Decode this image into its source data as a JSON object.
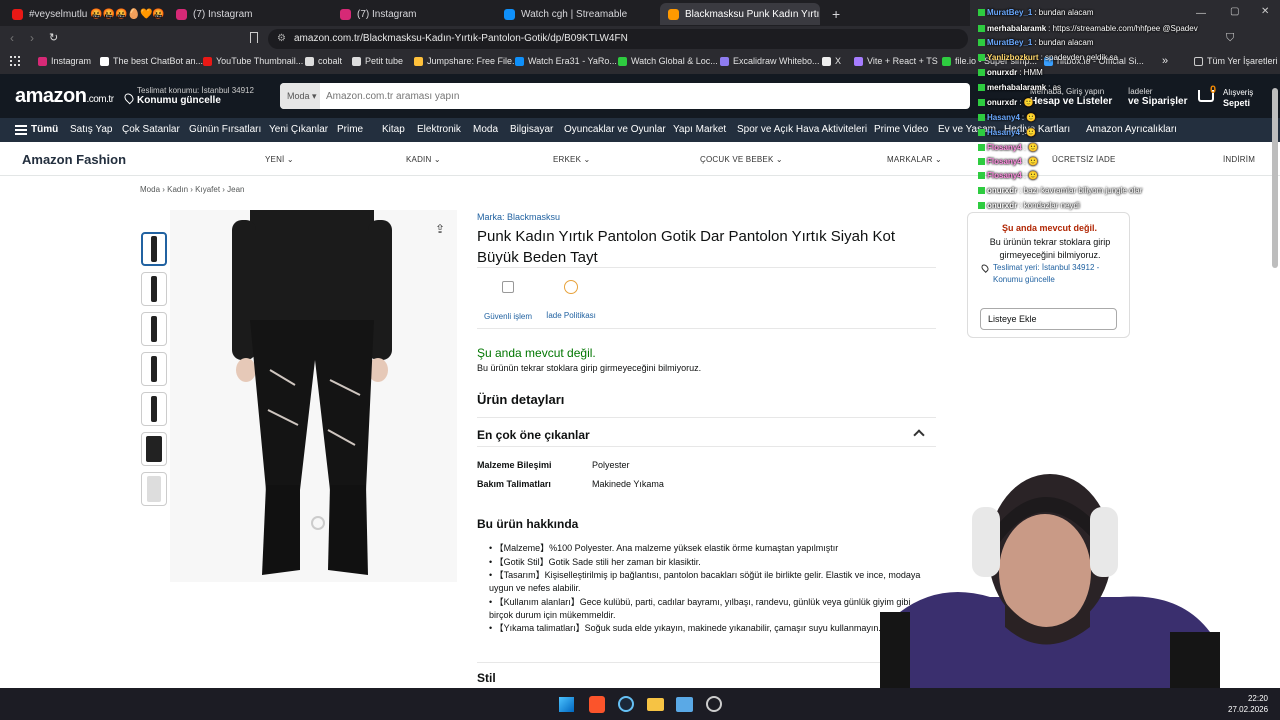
{
  "tabs": [
    {
      "label": "#veyselmutlu 🤬🤬🤬🥚🧡🤬 #veyselmutlu",
      "color": "#e91916"
    },
    {
      "label": "(7) Instagram",
      "color": "#d62976"
    },
    {
      "label": "(7) Instagram",
      "color": "#d62976"
    },
    {
      "label": "Watch cgh | Streamable",
      "color": "#0f90fa"
    },
    {
      "label": "Blackmasksu Punk Kadın Yırtık P",
      "color": "#ff9900"
    }
  ],
  "url": "amazon.com.tr/Blackmasksu-Kadın-Yırtık-Pantolon-Gotik/dp/B09KTLW4FN",
  "bookmarks": [
    "Instagram",
    "The best ChatBot an...",
    "YouTube Thumbnail...",
    "cobalt",
    "Petit tube",
    "Jumpshare: Free File...",
    "Watch Era31 - YaRo...",
    "Watch Global & Loc...",
    "Excalidraw Whitebo...",
    "X",
    "Vite + React + TS",
    "file.io - Super simp...",
    "hitbox.io - Official Si..."
  ],
  "bookmarks_all": "Tüm Yer İşaretleri",
  "amazon": {
    "logo": "amazon",
    "logo_tld": ".com.tr",
    "deliver_line1": "Teslimat konumu: İstanbul 34912",
    "deliver_line2": "Konumu güncelle",
    "search_category": "Moda",
    "search_placeholder": "Amazon.com.tr araması yapın",
    "account_line1": "Merhaba, Giriş yapın",
    "account_line2": "Hesap ve Listeler",
    "orders_line1": "İadeler",
    "orders_line2": "ve Siparişler",
    "cart_count": "0",
    "cart_line1": "Alışveriş",
    "cart_line2": "Sepeti"
  },
  "nav": [
    "Tümü",
    "Satış Yap",
    "Çok Satanlar",
    "Günün Fırsatları",
    "Yeni Çıkanlar",
    "Prime",
    "Kitap",
    "Elektronik",
    "Moda",
    "Bilgisayar",
    "Oyuncaklar ve Oyunlar",
    "Yapı Market",
    "Spor ve Açık Hava Aktiviteleri",
    "Prime Video",
    "Ev ve Yaşam",
    "Hediye Kartları",
    "Amazon Ayrıcalıkları"
  ],
  "fashion": {
    "title": "Amazon Fashion",
    "items": [
      "YENİ",
      "KADIN",
      "ERKEK",
      "ÇOCUK VE BEBEK",
      "MARKALAR",
      "ÜCRETSİZ İADE",
      "İNDİRİM"
    ]
  },
  "breadcrumb": [
    "Moda",
    "Kadın",
    "Kıyafet",
    "Jean"
  ],
  "product": {
    "brand": "Marka: Blackmasksu",
    "title_line1": "Punk Kadın Yırtık Pantolon Gotik Dar Pantolon Yırtık Siyah Kot",
    "title_line2": "Büyük Beden Tayt",
    "badge1": "Güvenli işlem",
    "badge2": "İade Politikası",
    "availability": "Şu anda mevcut değil.",
    "availability_note": "Bu ürünün tekrar stoklara girip girmeyeceğini bilmiyoruz.",
    "details_heading": "Ürün detayları",
    "highlights_heading": "En çok öne çıkanlar",
    "specs": [
      {
        "label": "Malzeme Bileşimi",
        "value": "Polyester"
      },
      {
        "label": "Bakım Talimatları",
        "value": "Makinede Yıkama"
      }
    ],
    "about_heading": "Bu ürün hakkında",
    "bullets": [
      "【Malzeme】%100 Polyester. Ana malzeme yüksek elastik örme kumaştan yapılmıştır",
      "【Gotik Stil】Gotik Sade stili her zaman bir klasiktir.",
      "【Tasarım】Kişiselleştirilmiş ip bağlantısı, pantolon bacakları söğüt ile birlikte gelir. Elastik ve ince, modaya uygun ve nefes alabilir.",
      "【Kullanım alanları】Gece kulübü, parti, cadılar bayramı, yılbaşı, randevu, günlük veya günlük giyim gibi birçok durum için mükemmeldir.",
      "【Yıkama talimatları】Soğuk suda elde yıkayın, makinede yıkanabilir, çamaşır suyu kullanmayın."
    ],
    "style_heading": "Stil"
  },
  "buybox": {
    "status": "Şu anda mevcut değil.",
    "note": "Bu ürünün tekrar stoklara girip girmeyeceğini bilmiyoruz.",
    "deliver": "Teslimat yeri: İstanbul 34912 - Konumu güncelle",
    "add_list": "Listeye Ekle"
  },
  "chat": [
    {
      "user": "MuratBey_1",
      "msg": ": bundan alacam",
      "color": "#6aa9ff"
    },
    {
      "user": "merhabalaramk",
      "msg": ": https://streamable.com/hhfpee @Spadev",
      "color": "#ffffff"
    },
    {
      "user": "MuratBey_1",
      "msg": ": bundan alacam",
      "color": "#6aa9ff"
    },
    {
      "user": "Yanlizbozkurt",
      "msg": ": spadevden geldik sa",
      "color": "#ffd76a"
    },
    {
      "user": "onurxdr",
      "msg": ": HMM",
      "color": "#ffffff"
    },
    {
      "user": "merhabalaramk",
      "msg": ": as",
      "color": "#ffffff"
    },
    {
      "user": "onurxdr",
      "msg": ": 🙂",
      "color": "#ffffff"
    },
    {
      "user": "Hasany4",
      "msg": ": 🙂",
      "color": "#6aa9ff"
    },
    {
      "user": "Hasany4",
      "msg": ": 🙂",
      "color": "#6aa9ff"
    },
    {
      "user": "Flosany4",
      "msg": ": 🙂",
      "color": "#ff8de0"
    },
    {
      "user": "Flosany4",
      "msg": ": 🙂",
      "color": "#ff8de0"
    },
    {
      "user": "Flosany4",
      "msg": ": 🙂",
      "color": "#ff8de0"
    },
    {
      "user": "onurxdr",
      "msg": ": bazı kavramlar biliyom jungle olar",
      "color": "#ffffff"
    },
    {
      "user": "onurxdr",
      "msg": ": kondazlar neydi",
      "color": "#ffffff"
    }
  ],
  "clock": {
    "time": "22:20",
    "date": "27.02.2026"
  }
}
